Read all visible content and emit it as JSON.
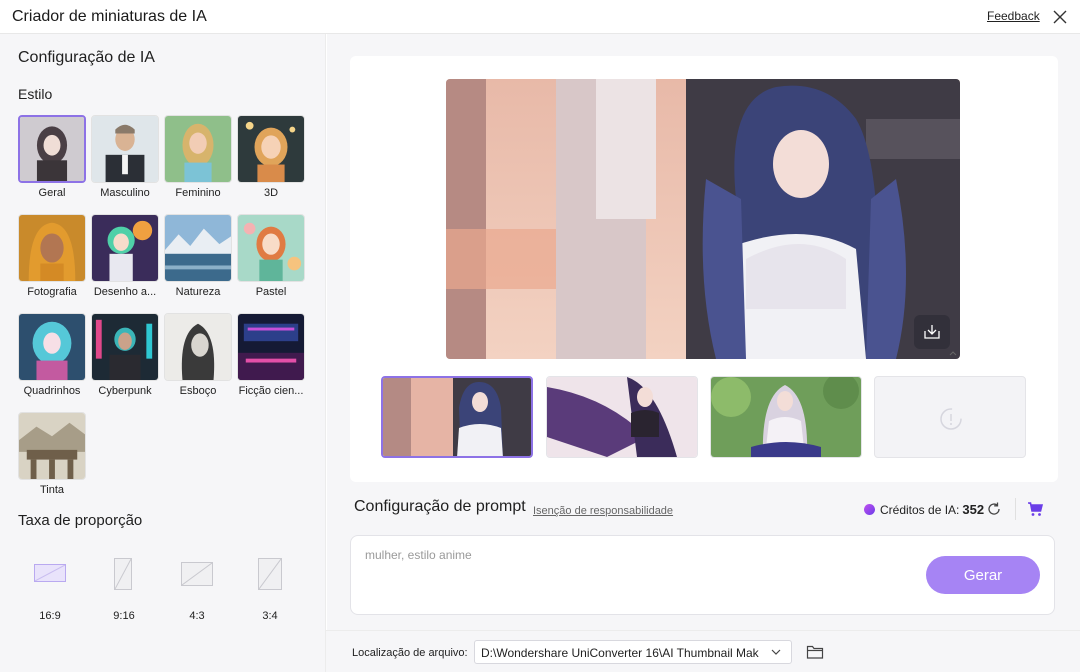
{
  "window": {
    "title": "Criador de miniaturas de IA",
    "feedback_label": "Feedback",
    "close_icon": "close-icon"
  },
  "left": {
    "section_title": "Configuração de IA",
    "style_label": "Estilo",
    "styles": [
      {
        "label": "Geral",
        "selected": true
      },
      {
        "label": "Masculino",
        "selected": false
      },
      {
        "label": "Feminino",
        "selected": false
      },
      {
        "label": "3D",
        "selected": false
      },
      {
        "label": "Fotografia",
        "selected": false
      },
      {
        "label": "Desenho a...",
        "selected": false
      },
      {
        "label": "Natureza",
        "selected": false
      },
      {
        "label": "Pastel",
        "selected": false
      },
      {
        "label": "Quadrinhos",
        "selected": false
      },
      {
        "label": "Cyberpunk",
        "selected": false
      },
      {
        "label": "Esboço",
        "selected": false
      },
      {
        "label": "Ficção cien...",
        "selected": false
      },
      {
        "label": "Tinta",
        "selected": false
      }
    ],
    "ratio_title": "Taxa de proporção",
    "ratios": [
      {
        "label": "16:9",
        "selected": true
      },
      {
        "label": "9:16",
        "selected": false
      },
      {
        "label": "4:3",
        "selected": false
      },
      {
        "label": "3:4",
        "selected": false
      }
    ]
  },
  "preview": {
    "download_icon": "download-icon",
    "thumbnails": [
      {
        "name": "thumbnail-1",
        "selected": true
      },
      {
        "name": "thumbnail-2",
        "selected": false
      },
      {
        "name": "thumbnail-3",
        "selected": false
      },
      {
        "name": "thumbnail-4-empty",
        "selected": false
      }
    ]
  },
  "prompt": {
    "title": "Configuração de prompt",
    "disclaimer": "Isenção de responsabilidade",
    "credits_label": "Créditos de IA:",
    "credits_value": "352",
    "placeholder": "mulher, estilo anime",
    "generate_label": "Gerar"
  },
  "footer": {
    "location_label": "Localização de arquivo:",
    "path": "D:\\Wondershare UniConverter 16\\AI Thumbnail Mak"
  },
  "colors": {
    "accent": "#8d72e6",
    "generate_button": "#a684f4",
    "panel_bg": "#f6f6f8"
  }
}
